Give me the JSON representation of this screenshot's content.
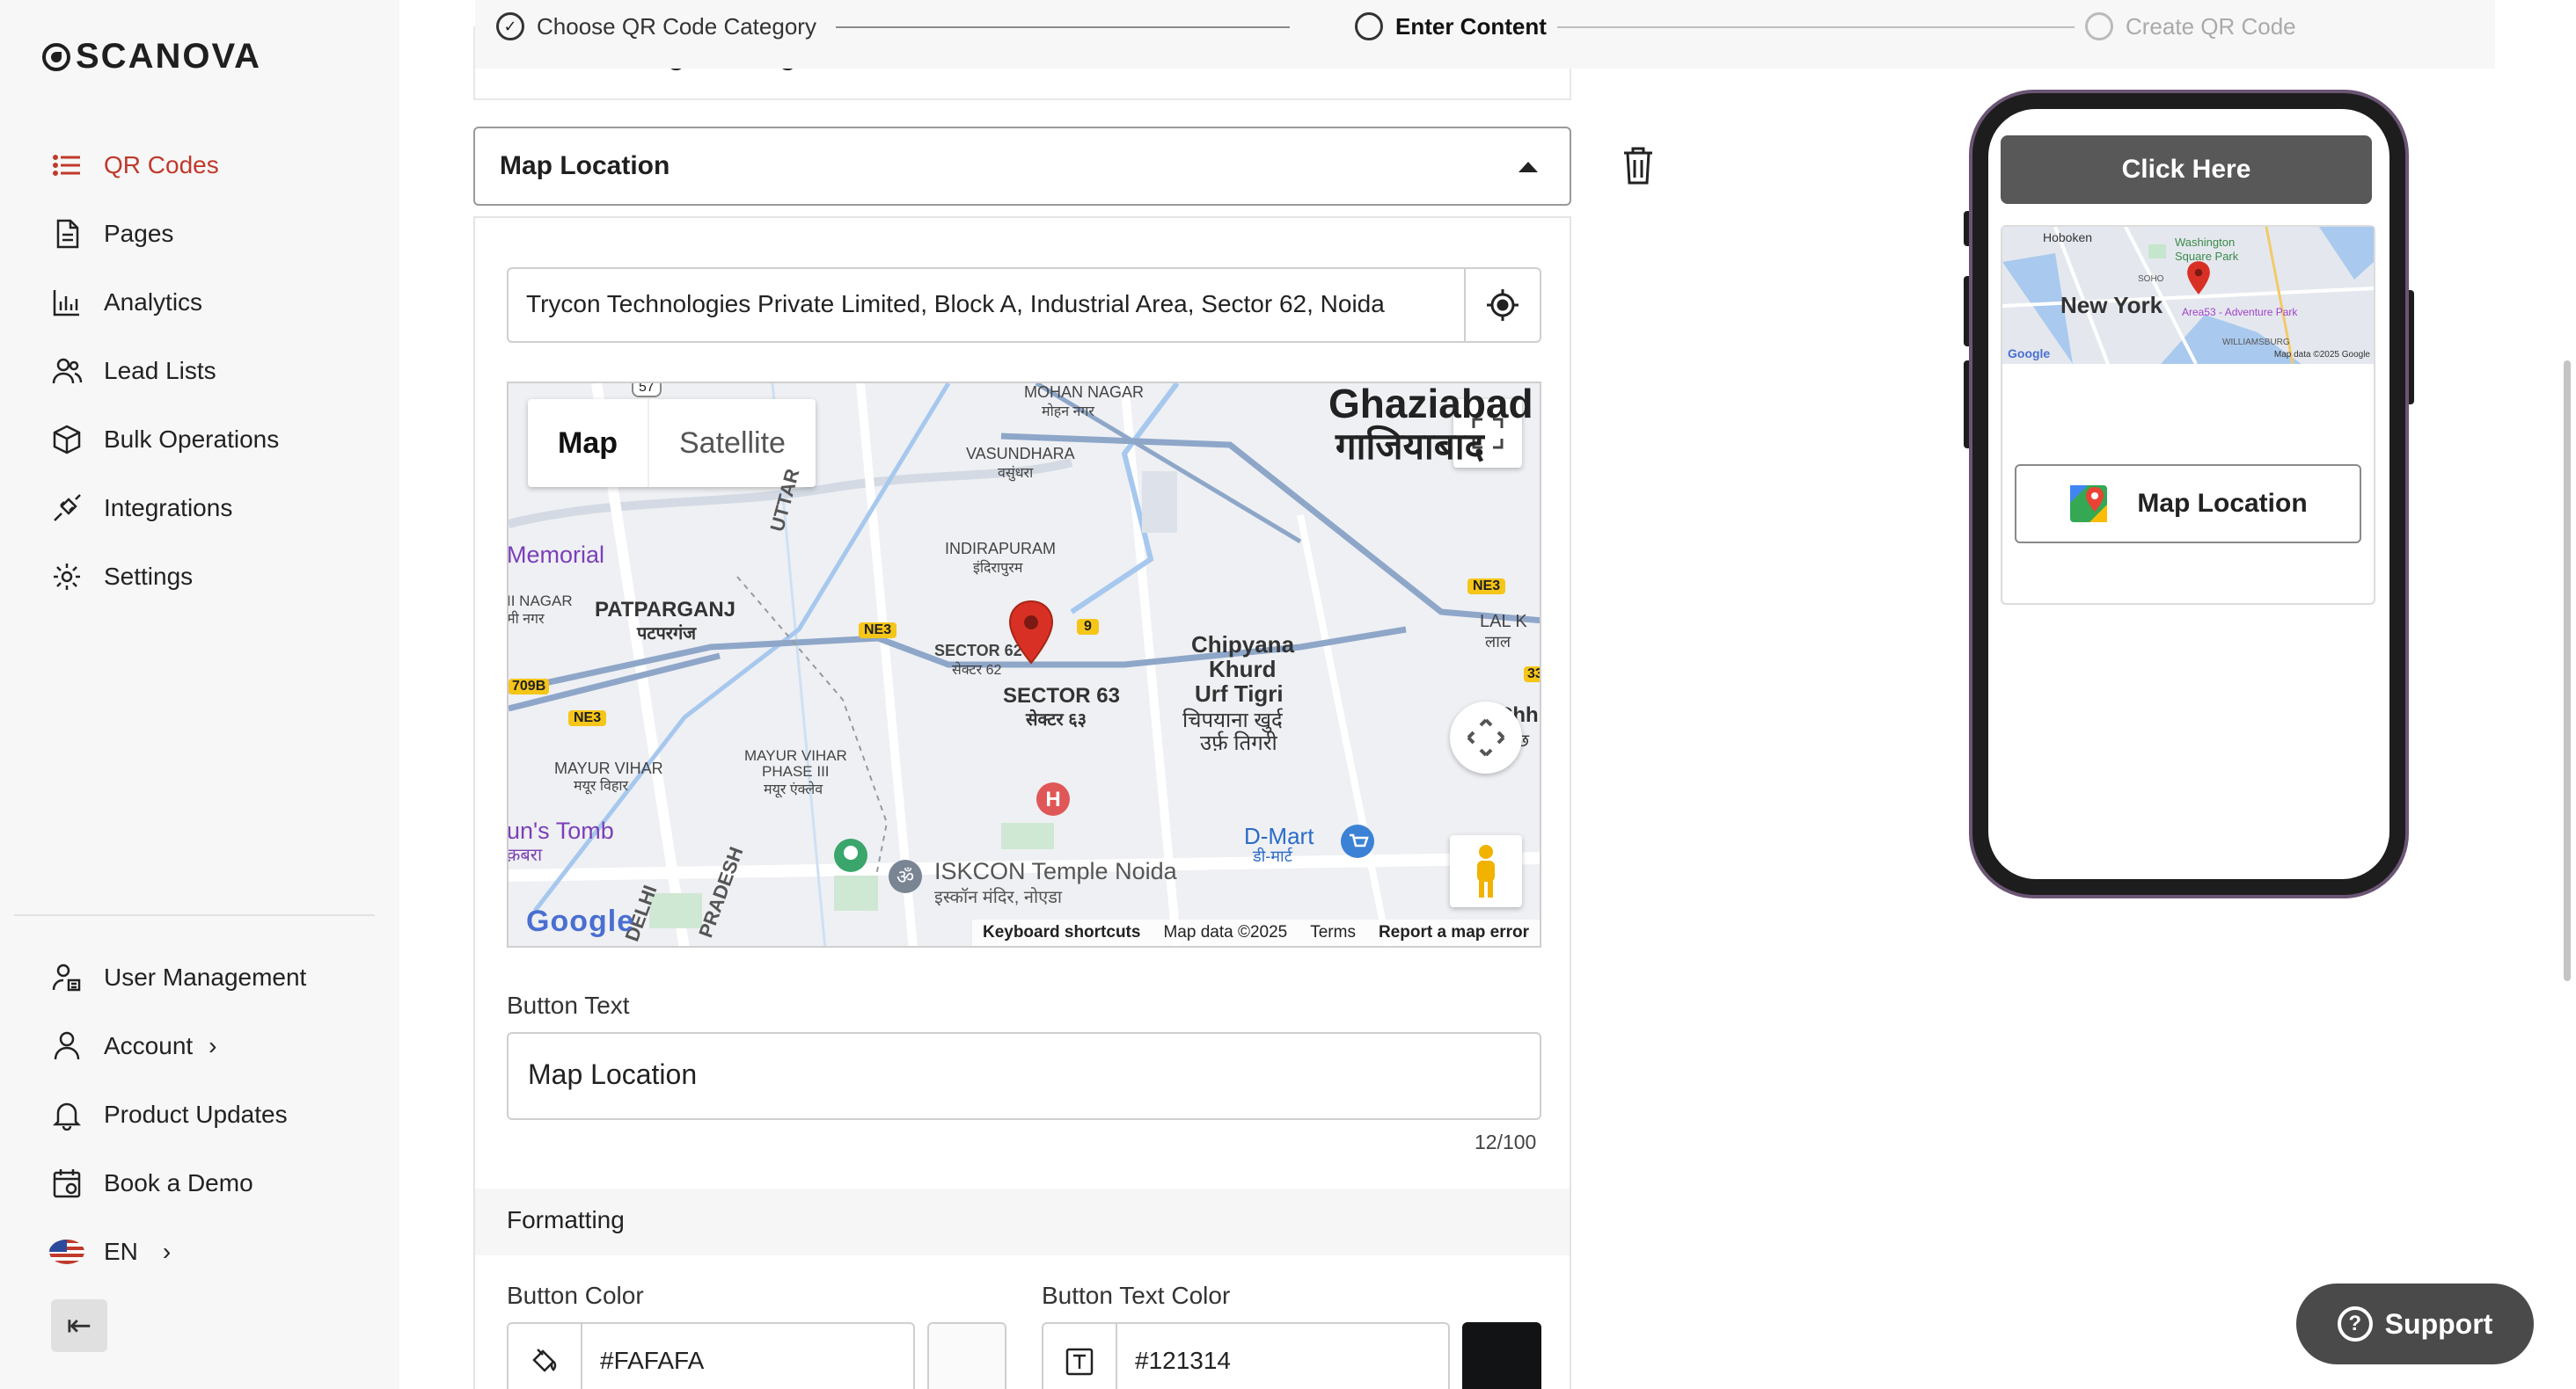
{
  "brand": {
    "name": "SCANOVA"
  },
  "sidebar": {
    "items": [
      {
        "label": "QR Codes",
        "icon": "list-icon"
      },
      {
        "label": "Pages",
        "icon": "document-icon"
      },
      {
        "label": "Analytics",
        "icon": "bar-chart-icon"
      },
      {
        "label": "Lead Lists",
        "icon": "users-icon"
      },
      {
        "label": "Bulk Operations",
        "icon": "cube-icon"
      },
      {
        "label": "Integrations",
        "icon": "plug-icon"
      },
      {
        "label": "Settings",
        "icon": "gear-icon"
      }
    ],
    "bottom_items": [
      {
        "label": "User Management",
        "icon": "user-manage-icon"
      },
      {
        "label": "Account",
        "icon": "user-icon"
      },
      {
        "label": "Product Updates",
        "icon": "bell-icon"
      },
      {
        "label": "Book a Demo",
        "icon": "calendar-icon"
      },
      {
        "label": "EN",
        "icon": "us-flag-icon"
      }
    ]
  },
  "stepper": {
    "steps": [
      {
        "label": "Choose QR Code Category",
        "state": "done"
      },
      {
        "label": "Enter Content",
        "state": "current"
      },
      {
        "label": "Create QR Code",
        "state": "upcoming"
      }
    ]
  },
  "form": {
    "collapsed_section": "Additional Page Settings",
    "section_title": "Map Location",
    "address_value": "Trycon Technologies Private Limited, Block A, Industrial Area, Sector 62, Noida",
    "map": {
      "tab_map": "Map",
      "tab_satellite": "Satellite",
      "footer_shortcuts": "Keyboard shortcuts",
      "footer_data": "Map data ©2025",
      "footer_terms": "Terms",
      "footer_report": "Report a map error",
      "google": "Google",
      "places": {
        "ghaziabad_en": "Ghaziabad",
        "ghaziabad_hi": "गाजियाबाद",
        "mohan_nagar_en": "MOHAN NAGAR",
        "mohan_nagar_hi": "मोहन नगर",
        "vasundhara_en": "VASUNDHARA",
        "vasundhara_hi": "वसुंधरा",
        "indirapuram_en": "INDIRAPURAM",
        "indirapuram_hi": "इंदिरापुरम",
        "memorial": "Memorial",
        "patparganj_en": "PATPARGANJ",
        "patparganj_hi": "पटपरगंज",
        "nagar_en": "II NAGAR",
        "nagar_hi": "मी नगर",
        "sector62_en": "SECTOR 62",
        "sector62_hi": "सेक्टर 62",
        "sector63_en": "SECTOR 63",
        "sector63_hi": "सेक्टर ६३",
        "chipyana_en_1": "Chipyana",
        "chipyana_en_2": "Khurd",
        "chipyana_en_3": "Urf Tigri",
        "chipyana_hi_1": "चिपयाना खुर्द",
        "chipyana_hi_2": "उर्फ़ तिगरी",
        "lal_kuan_en": "LAL K",
        "lal_kuan_hi": "लाल",
        "mayur_vihar_en": "MAYUR VIHAR",
        "mayur_vihar_hi": "मयूर विहार",
        "mayur_vihar3_en_1": "MAYUR VIHAR",
        "mayur_vihar3_en_2": "PHASE III",
        "mayur_vihar3_hi": "मयूर एंक्लेव",
        "tomb_en": "un's Tomb",
        "tomb_hi": "क़बरा",
        "iskcon_en": "ISKCON Temple Noida",
        "iskcon_hi": "इस्कॉन मंदिर, नोएडा",
        "dmart_en": "D-Mart",
        "dmart_hi": "डी-मार्ट",
        "delhi": "DELHI",
        "pradesh": "PRADESH",
        "uttar": "UTTAR",
        "chh": "Chh",
        "chh_hi": "छ",
        "ne3": "NE3",
        "r9": "9",
        "r709b": "709B",
        "r57": "57",
        "r33": "33"
      }
    },
    "button_text_label": "Button Text",
    "button_text_value": "Map Location",
    "button_text_counter": "12/100",
    "formatting_title": "Formatting",
    "button_color_label": "Button Color",
    "button_color_value": "#FAFAFA",
    "button_text_color_label": "Button Text Color",
    "button_text_color_value": "#121314"
  },
  "preview": {
    "click_here": "Click Here",
    "map_button_label": "Map Location",
    "mini_map": {
      "hoboken": "Hoboken",
      "washington_sq_1": "Washington",
      "washington_sq_2": "Square Park",
      "new_york": "New York",
      "soho": "SOHO",
      "area53": "Area53 - Adventure Park",
      "williamsburg": "WILLIAMSBURG",
      "google": "Google",
      "map_data": "Map data ©2025 Google"
    }
  },
  "support": {
    "label": "Support"
  },
  "colors": {
    "accent": "#c0392b",
    "dark_button": "#585858",
    "support_bg": "#4a4a4a",
    "button_swatch": "#FAFAFA",
    "text_swatch": "#121314"
  }
}
